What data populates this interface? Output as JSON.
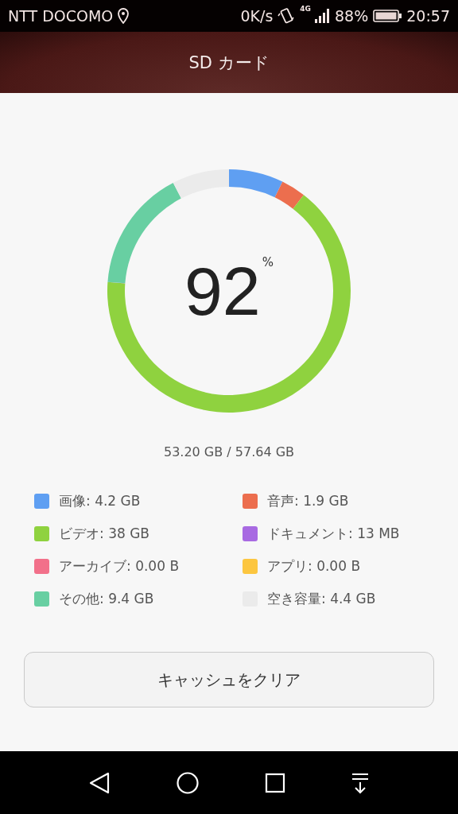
{
  "status_bar": {
    "carrier": "NTT DOCOMO",
    "speed": "0K/s",
    "network": "4G",
    "battery": "88%",
    "time": "20:57"
  },
  "header": {
    "title": "SD カード"
  },
  "usage": {
    "percent": "92",
    "percent_sign": "%",
    "summary": "53.20 GB / 57.64 GB",
    "chart_data": {
      "type": "donut",
      "categories": [
        "画像",
        "音声",
        "ビデオ",
        "ドキュメント",
        "アーカイブ",
        "アプリ",
        "その他",
        "空き容量"
      ],
      "values": [
        7.25,
        3.28,
        65.63,
        0.02,
        0,
        0,
        16.23,
        7.59
      ]
    }
  },
  "legend": [
    {
      "size": ": 4.2 GB",
      "color": "#5f9ff2"
    },
    {
      "size": ": 1.9 GB",
      "color": "#ec6e4e"
    },
    {
      "size": ": 38 GB",
      "color": "#8fd23f"
    },
    {
      "size": ": 13 MB",
      "color": "#a86ae2"
    },
    {
      "size": ": 0.00 B",
      "color": "#f2708a"
    },
    {
      "size": ": 0.00 B",
      "color": "#fcc640"
    },
    {
      "size": ": 9.4 GB",
      "color": "#68cfa2"
    },
    {
      "size": ": 4.4 GB",
      "color": "#ebebeb"
    }
  ],
  "clear_button": {
    "label": "キャッシュをクリア"
  }
}
